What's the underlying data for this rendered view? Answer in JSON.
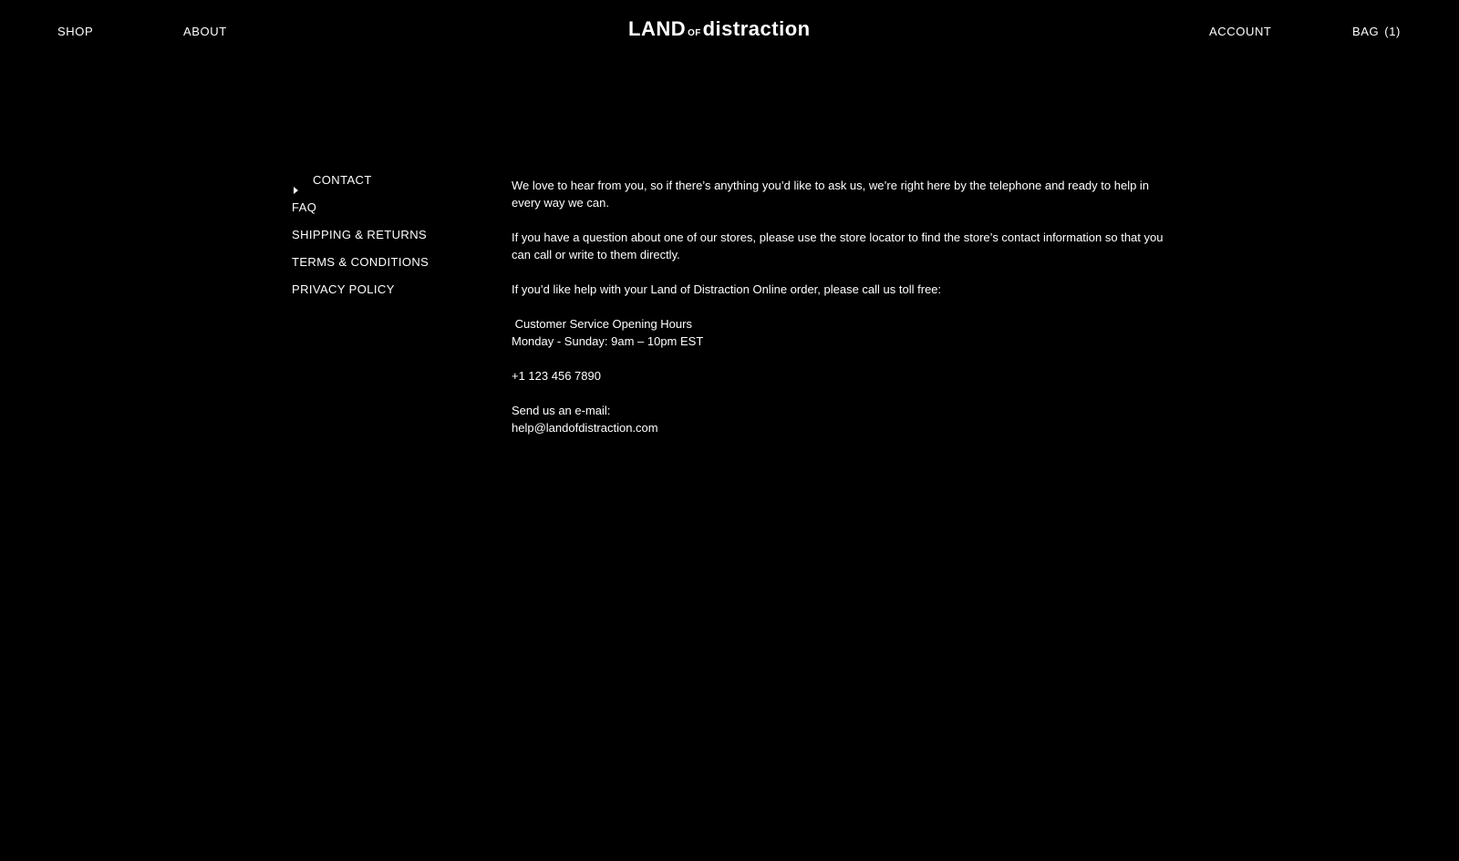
{
  "header": {
    "nav_left": {
      "shop": "SHOP",
      "about": "ABOUT"
    },
    "logo": {
      "part1": "LAND",
      "part2": "OF",
      "part3": "distraction"
    },
    "nav_right": {
      "account": "ACCOUNT",
      "bag": "BAG",
      "bag_count": "(1)"
    }
  },
  "sidebar": {
    "active_icon": "caret-right-icon",
    "items": [
      {
        "label": "CONTACT"
      },
      {
        "label": "FAQ"
      },
      {
        "label": "SHIPPING & RETURNS"
      },
      {
        "label": "TERMS & CONDITIONS"
      },
      {
        "label": "PRIVACY POLICY"
      }
    ]
  },
  "content": {
    "intro": "We love to hear from you, so if there’s anything you’d like to ask us, we’re right here by the telephone and ready to help in every way we can.",
    "stores": "If you have a question about one of our stores, please use the store locator to find the store’s contact information so that you can call or write to them directly.",
    "online": "If you’d like help with your Land of Distraction Online order, please call us toll free:",
    "hours_title": " Customer Service Opening Hours",
    "hours": "Monday - Sunday: 9am – 10pm EST",
    "phone": "+1 123 456 7890",
    "email_label": "Send us an e-mail:",
    "email": "help@landofdistraction.com"
  },
  "colors": {
    "background": "#000000",
    "text": "#ffffff"
  }
}
